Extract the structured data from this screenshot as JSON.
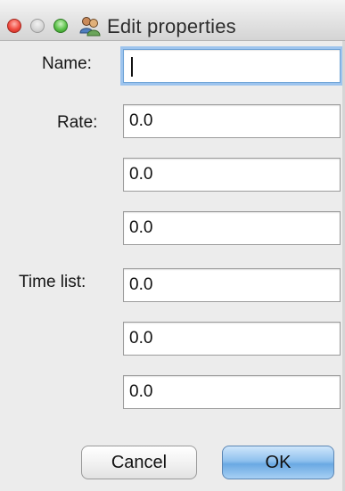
{
  "window": {
    "title": "Edit properties"
  },
  "icons": {
    "close": "close-icon",
    "minimize": "minimize-icon",
    "zoom": "zoom-icon",
    "app": "users-icon"
  },
  "form": {
    "name_label": "Name:",
    "name_value": "",
    "rate_label": "Rate:",
    "rate_values": [
      "0.0",
      "0.0",
      "0.0"
    ],
    "time_list_label": "Time list:",
    "time_list_values": [
      "0.0",
      "0.0",
      "0.0"
    ]
  },
  "buttons": {
    "cancel": "Cancel",
    "ok": "OK"
  },
  "colors": {
    "accent": "#6ea3d6",
    "ok_button": "#8fc1ee"
  }
}
